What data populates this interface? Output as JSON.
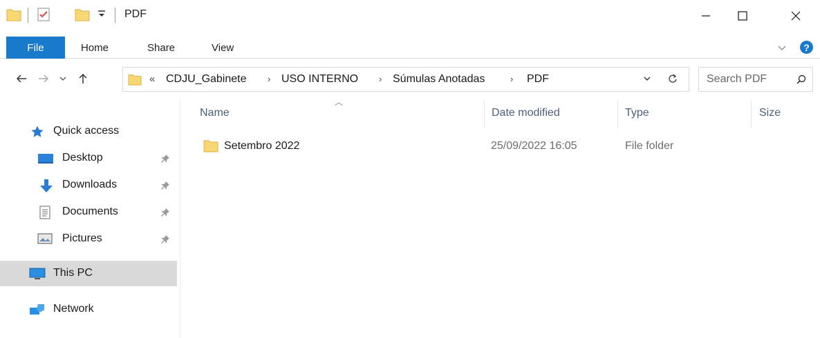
{
  "window": {
    "title": "PDF",
    "controls": {
      "minimize": "—",
      "maximize": "☐",
      "close": "✕"
    }
  },
  "ribbon": {
    "tabs": [
      {
        "label": "File"
      },
      {
        "label": "Home"
      },
      {
        "label": "Share"
      },
      {
        "label": "View"
      }
    ],
    "help": "?"
  },
  "address_bar": {
    "overflow": "«",
    "crumbs": [
      "CDJU_Gabinete",
      "USO INTERNO",
      "Súmulas Anotadas",
      "PDF"
    ],
    "separator": "›"
  },
  "search": {
    "placeholder": "Search PDF"
  },
  "nav_pane": {
    "items": [
      {
        "label": "Quick access",
        "icon": "star-icon"
      },
      {
        "label": "Desktop",
        "icon": "desktop-icon",
        "pinned": true
      },
      {
        "label": "Downloads",
        "icon": "download-icon",
        "pinned": true
      },
      {
        "label": "Documents",
        "icon": "documents-icon",
        "pinned": true
      },
      {
        "label": "Pictures",
        "icon": "pictures-icon",
        "pinned": true
      },
      {
        "label": "This PC",
        "icon": "computer-icon",
        "selected": true
      },
      {
        "label": "Network",
        "icon": "network-icon"
      }
    ]
  },
  "file_list": {
    "columns": [
      "Name",
      "Date modified",
      "Type",
      "Size"
    ],
    "sort_column": "Name",
    "rows": [
      {
        "name": "Setembro 2022",
        "date_modified": "25/09/2022 16:05",
        "type": "File folder",
        "size": "",
        "icon": "folder-icon"
      }
    ]
  },
  "colors": {
    "accent": "#1979ca",
    "folder": "#f8d775",
    "selected_bg": "#d9d9d9",
    "header_text": "#4c607a"
  }
}
